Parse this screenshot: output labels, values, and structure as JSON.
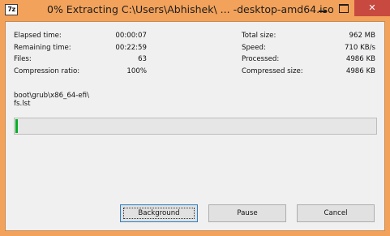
{
  "window": {
    "title": "0% Extracting C:\\Users\\Abhishek\\ ... -desktop-amd64.iso",
    "app_icon_text": "7z",
    "accent_color": "#f2a25b",
    "close_color": "#c7493f"
  },
  "stats_left": [
    {
      "label": "Elapsed time:",
      "value": "00:00:07"
    },
    {
      "label": "Remaining time:",
      "value": "00:22:59"
    },
    {
      "label": "Files:",
      "value": "63"
    },
    {
      "label": "Compression ratio:",
      "value": "100%"
    }
  ],
  "stats_right": [
    {
      "label": "Total size:",
      "value": "962 MB"
    },
    {
      "label": "Speed:",
      "value": "710 KB/s"
    },
    {
      "label": "Processed:",
      "value": "4986 KB"
    },
    {
      "label": "Compressed size:",
      "value": "4986 KB"
    }
  ],
  "current": {
    "folder": "boot\\grub\\x86_64-efi\\",
    "file": "fs.lst"
  },
  "progress": {
    "fraction": 0.005,
    "fill_color": "#06b025"
  },
  "buttons": {
    "background": "Background",
    "pause": "Pause",
    "cancel": "Cancel"
  }
}
